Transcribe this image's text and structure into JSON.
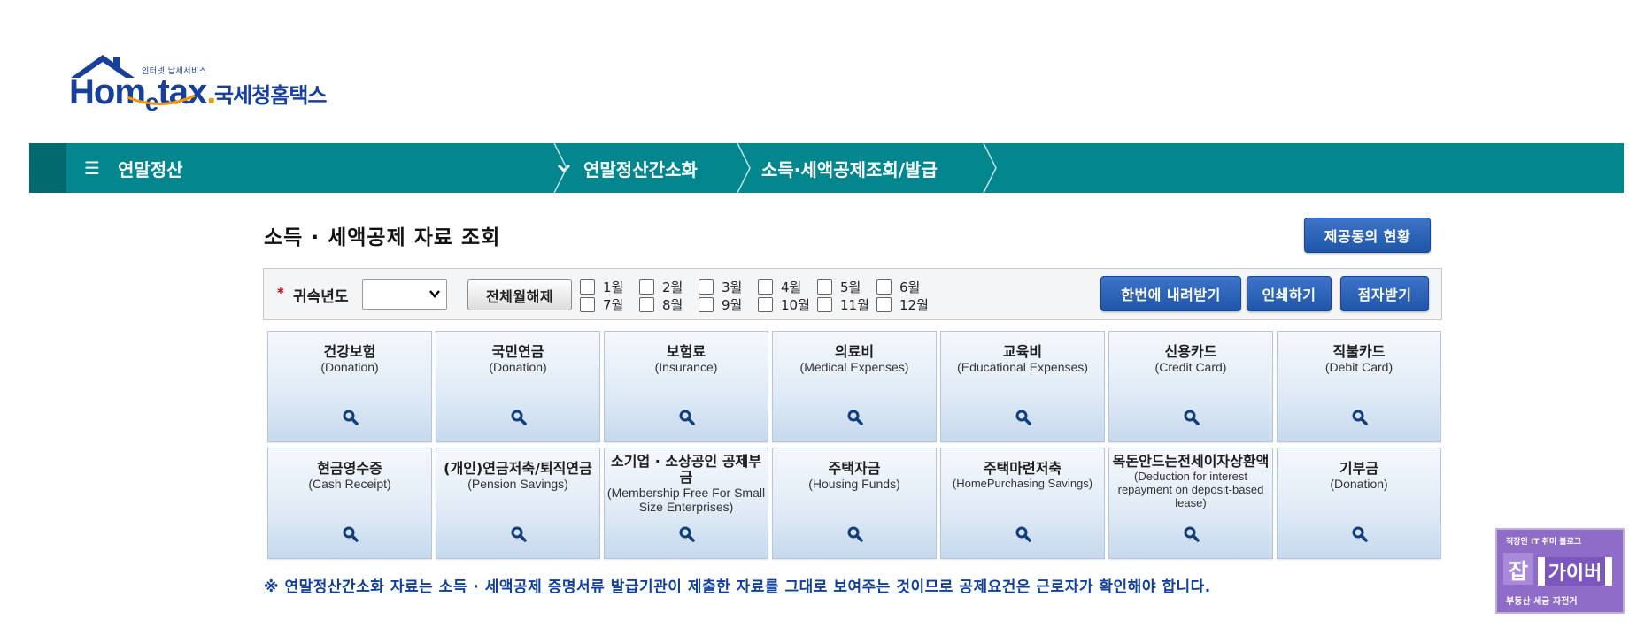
{
  "logo": {
    "tagline": "인터넷 납세서비스",
    "home": "Hom",
    "e": "e",
    "tax": "tax",
    "dot": ".",
    "korean": "국세청홈택스"
  },
  "nav": {
    "menu_label": "연말정산",
    "menu_icon": "hamburger-icon",
    "dropdown_icon": "chevron-down-icon",
    "crumbs": [
      "연말정산간소화",
      "소득·세액공제조회/발급"
    ]
  },
  "page": {
    "title": "소득 · 세액공제 자료 조회",
    "provider_status_button": "제공동의 현황"
  },
  "filter": {
    "year_label": "귀속년도",
    "year_value": "",
    "select_all_button": "전체월해제",
    "months": [
      "1월",
      "2월",
      "3월",
      "4월",
      "5월",
      "6월",
      "7월",
      "8월",
      "9월",
      "10월",
      "11월",
      "12월"
    ],
    "download_all_button": "한번에 내려받기",
    "print_button": "인쇄하기",
    "braille_button": "점자받기"
  },
  "tiles": [
    {
      "kr": "건강보험",
      "en": "(Donation)"
    },
    {
      "kr": "국민연금",
      "en": "(Donation)"
    },
    {
      "kr": "보험료",
      "en": "(Insurance)"
    },
    {
      "kr": "의료비",
      "en": "(Medical Expenses)"
    },
    {
      "kr": "교육비",
      "en": "(Educational Expenses)"
    },
    {
      "kr": "신용카드",
      "en": "(Credit Card)"
    },
    {
      "kr": "직불카드",
      "en": "(Debit Card)"
    },
    {
      "kr": "현금영수증",
      "en": "(Cash Receipt)"
    },
    {
      "kr": "(개인)연금저축/퇴직연금",
      "en": "(Pension Savings)"
    },
    {
      "kr": "소기업 · 소상공인 공제부금",
      "en": "(Membership Free For Small Size Enterprises)"
    },
    {
      "kr": "주택자금",
      "en": "(Housing Funds)"
    },
    {
      "kr": "주택마련저축",
      "en": "(HomePurchasing Savings)"
    },
    {
      "kr": "목돈안드는전세이자상환액",
      "en": "(Deduction for interest repayment on deposit-based lease)"
    },
    {
      "kr": "기부금",
      "en": "(Donation)"
    }
  ],
  "notice": "※ 연말정산간소화 자료는 소득 · 세액공제 증명서류 발급기관이 제출한 자료를 그대로 보여주는 것이므로 공제요건은 근로자가 확인해야 합니다.",
  "badge": {
    "top": "직장인 IT 취미 블로그",
    "char": "잡",
    "word": "가이버",
    "bottom": "부동산 세금 자전거"
  },
  "colors": {
    "nav_teal": "#03868d",
    "button_blue": "#2a62b8",
    "notice_blue": "#123f9a"
  }
}
